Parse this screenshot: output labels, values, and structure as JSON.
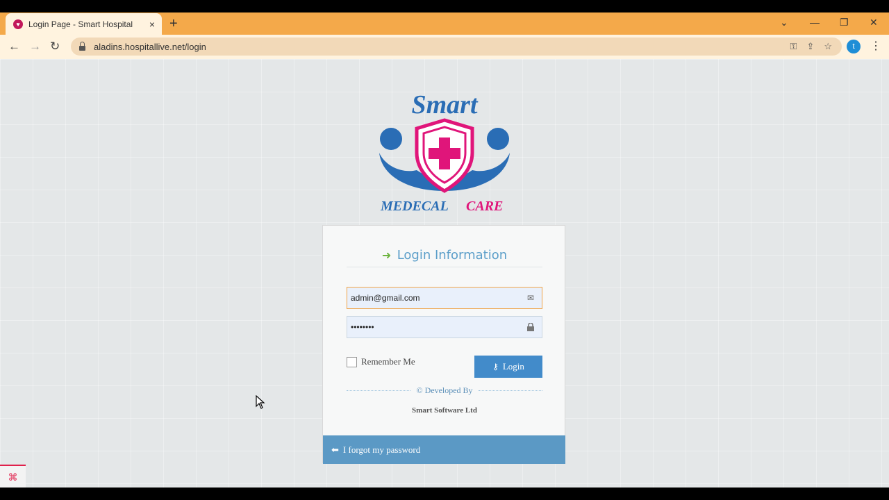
{
  "browser": {
    "tab_title": "Login Page - Smart Hospital",
    "new_tab_symbol": "+",
    "close_symbol": "×",
    "url": "aladins.hospitallive.net/login",
    "profile_initial": "t"
  },
  "logo": {
    "line1": "Smart",
    "line2a": "MEDECAL",
    "line2b": "CARE"
  },
  "form": {
    "heading": "Login Information",
    "email_value": "admin@gmail.com",
    "password_value": "••••••••",
    "remember_label": "Remember Me",
    "login_label": "Login",
    "developed_by": "© Developed By",
    "company": "Smart Software Ltd",
    "forgot_label": "I forgot my password"
  },
  "colors": {
    "browser_accent": "#f4a94a",
    "primary_blue": "#428bca",
    "logo_blue": "#2a6db5",
    "logo_magenta": "#e0157a",
    "heading_green": "#6cb33e"
  },
  "icons": {
    "heading": "sign-in-icon",
    "email": "envelope-icon",
    "password": "lock-icon",
    "login": "key-icon",
    "forgot": "arrow-left-icon"
  }
}
